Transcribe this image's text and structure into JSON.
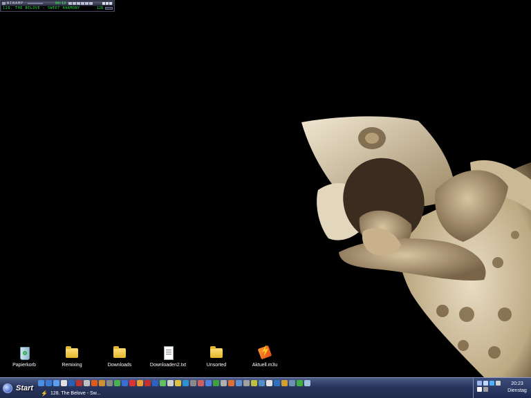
{
  "winamp": {
    "title": "WINAMP",
    "time": "04:13",
    "song": "128. THE BELOVE - SWEET HARMONY",
    "kbps": "128"
  },
  "desktop_icons": [
    {
      "label": "Papierkorb",
      "icon": "recycle-bin-icon"
    },
    {
      "label": "Remixing",
      "icon": "folder-icon"
    },
    {
      "label": "Downloads",
      "icon": "folder-icon"
    },
    {
      "label": "Downloaden2.txt",
      "icon": "text-file-icon"
    },
    {
      "label": "Unsorted",
      "icon": "folder-icon"
    },
    {
      "label": "Aktuell.m3u",
      "icon": "playlist-file-icon"
    }
  ],
  "taskbar": {
    "start_label": "Start",
    "task_button_label": "128. The Belove - Sw...",
    "quick_launch_colors": [
      "#4a8fe0",
      "#3a7bd5",
      "#5aa0f0",
      "#e0e0e0",
      "#2f5fb0",
      "#b33",
      "#c0c0c0",
      "#e05a1a",
      "#d09030",
      "#888",
      "#4caf50",
      "#3a6ed0",
      "#d33",
      "#e8a030",
      "#c03030",
      "#3060c0",
      "#60c060",
      "#cfcfcf",
      "#e0c040",
      "#3090d0",
      "#8a8a8a",
      "#d06060",
      "#5080e0",
      "#40a040",
      "#b0b0b0",
      "#e07030",
      "#6090d0",
      "#a0a0a0",
      "#c0c040",
      "#5090c0",
      "#e0e0e0",
      "#3070c0",
      "#d0a030",
      "#7090b0",
      "#40b040",
      "#a0c0e0"
    ]
  },
  "tray": {
    "time": "20:23",
    "day": "Dienstag",
    "icon_colors": [
      "#9ab8f0",
      "#c0d8ff",
      "#4fb0ff",
      "#d0d0d0",
      "#ffffff",
      "#a0a0a0"
    ]
  }
}
